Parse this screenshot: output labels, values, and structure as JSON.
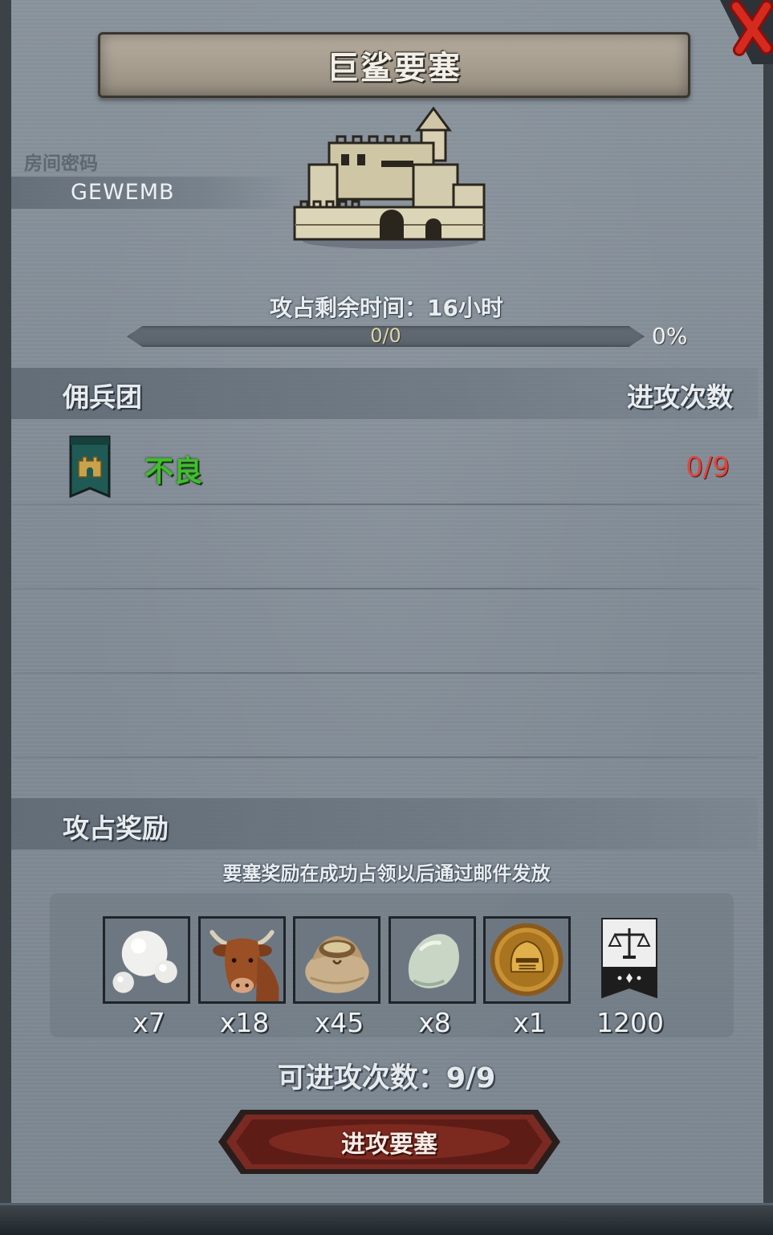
{
  "title": "巨鲨要塞",
  "room": {
    "label": "房间密码",
    "code": "GEWEMB"
  },
  "timer": {
    "text": "攻占剩余时间：16小时"
  },
  "progress": {
    "text": "0/0",
    "percent_text": "0%",
    "fraction": 0
  },
  "mercenary_section": {
    "title": "佣兵团",
    "attack_count_header": "进攻次数"
  },
  "mercenaries": [
    {
      "name": "不良",
      "attacks": "0/9",
      "name_color": "#3fbf2e",
      "attacks_color": "#e0453f"
    }
  ],
  "reward_section": {
    "title": "攻占奖励",
    "note": "要塞奖励在成功占领以后通过邮件发放"
  },
  "rewards": [
    {
      "icon": "pearl-icon",
      "qty": "x7"
    },
    {
      "icon": "cow-icon",
      "qty": "x18"
    },
    {
      "icon": "grain-sack-icon",
      "qty": "x45"
    },
    {
      "icon": "jade-stone-icon",
      "qty": "x8"
    },
    {
      "icon": "knight-coin-icon",
      "qty": "x1"
    },
    {
      "icon": "justice-banner-icon",
      "qty": "1200"
    }
  ],
  "attempts": {
    "text": "可进攻次数：9/9"
  },
  "attack_button": {
    "label": "进攻要塞"
  }
}
